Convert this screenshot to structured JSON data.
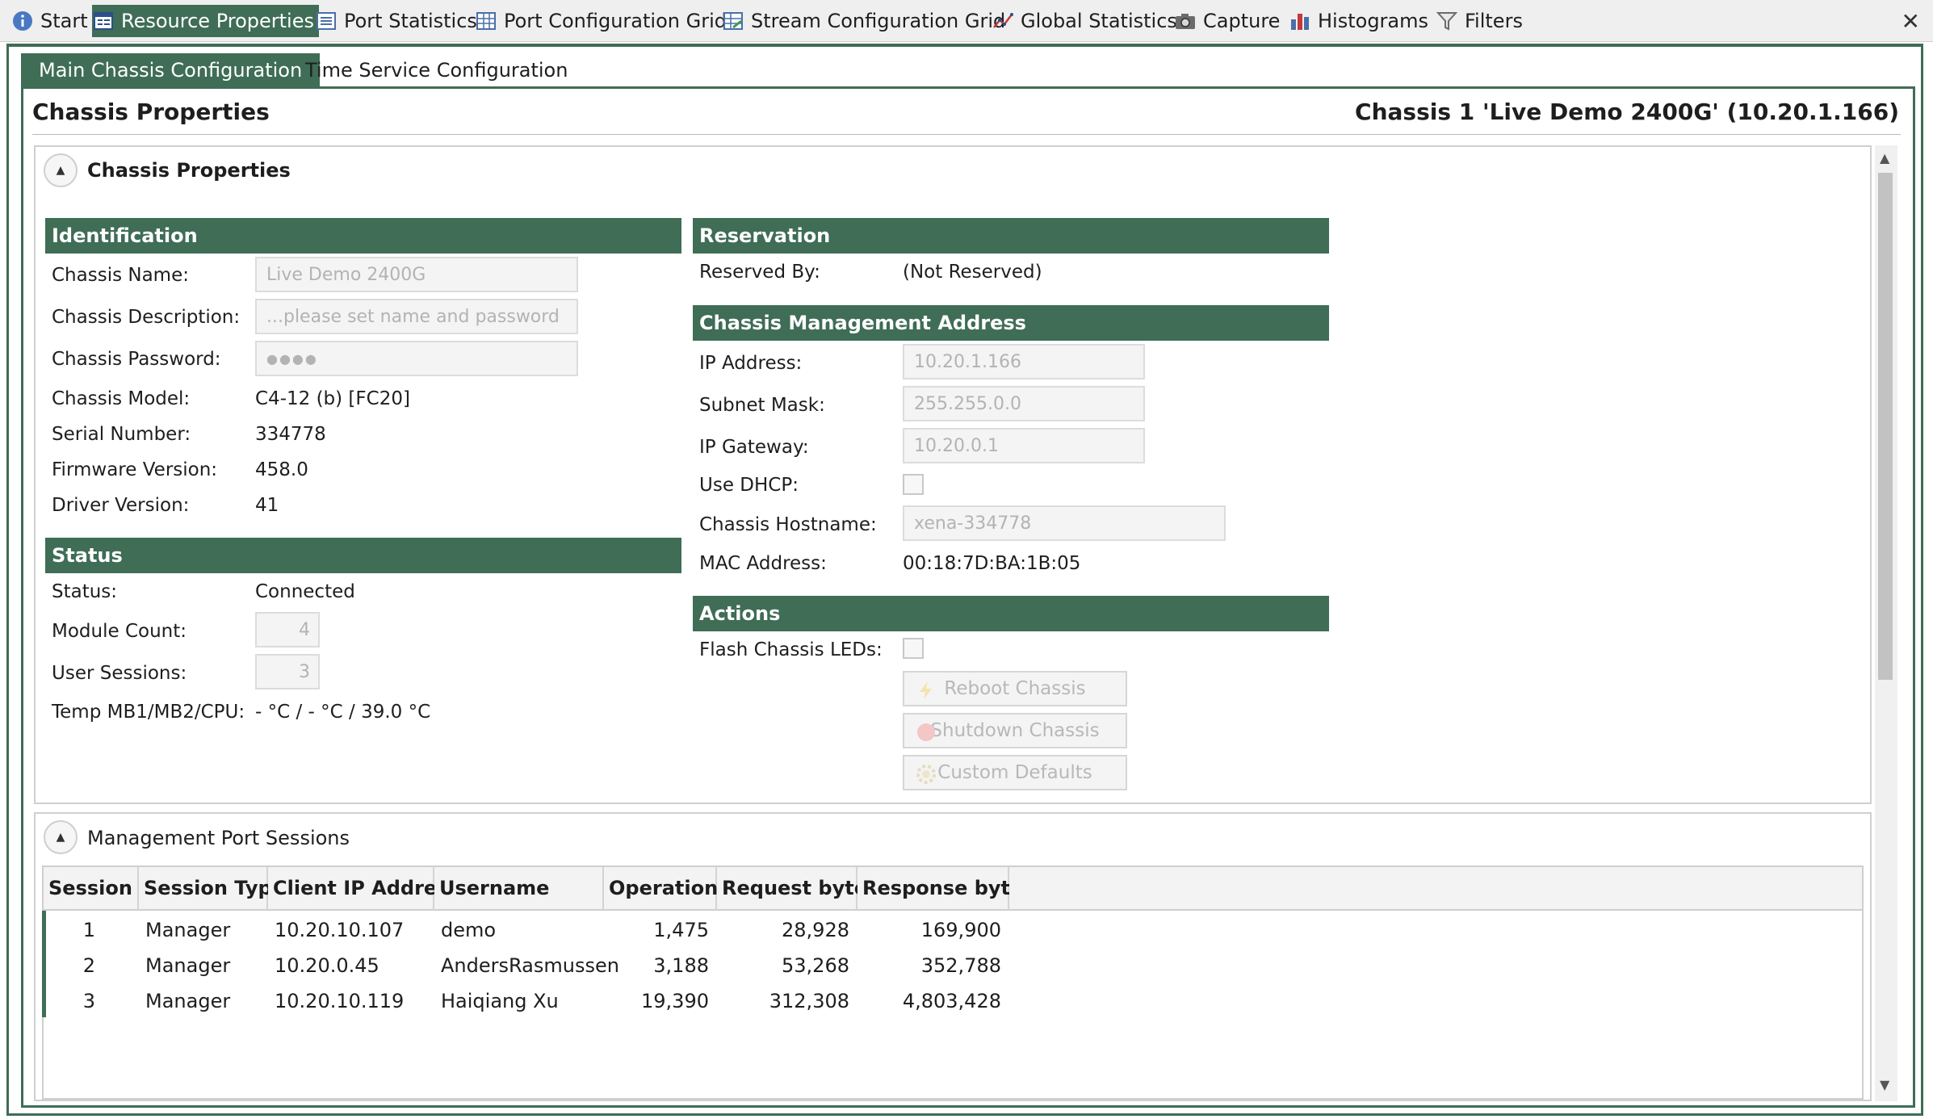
{
  "top_tabs": [
    {
      "label": "Start",
      "icon": "info-icon"
    },
    {
      "label": "Resource Properties",
      "icon": "properties-icon",
      "active": true
    },
    {
      "label": "Port Statistics",
      "icon": "list-icon"
    },
    {
      "label": "Port Configuration Grid",
      "icon": "grid-icon"
    },
    {
      "label": "Stream Configuration Grid",
      "icon": "grid-arrow-icon"
    },
    {
      "label": "Global Statistics",
      "icon": "line-chart-icon"
    },
    {
      "label": "Capture",
      "icon": "camera-icon"
    },
    {
      "label": "Histograms",
      "icon": "bar-chart-icon"
    },
    {
      "label": "Filters",
      "icon": "funnel-icon"
    }
  ],
  "close_glyph": "✕",
  "sub_tabs": [
    {
      "label": "Main Chassis Configuration",
      "active": true
    },
    {
      "label": "Time Service Configuration"
    }
  ],
  "header": {
    "title": "Chassis Properties",
    "chassis_label": "Chassis 1 'Live Demo 2400G' (10.20.1.166)"
  },
  "chassis_group": {
    "title": "Chassis Properties",
    "identification": {
      "header": "Identification",
      "name_label": "Chassis Name:",
      "name_value": "Live Demo 2400G",
      "desc_label": "Chassis Description:",
      "desc_value": "...please set name and password",
      "password_label": "Chassis Password:",
      "password_value": "●●●●",
      "model_label": "Chassis Model:",
      "model_value": "C4-12 (b) [FC20]",
      "serial_label": "Serial Number:",
      "serial_value": "334778",
      "firmware_label": "Firmware Version:",
      "firmware_value": "458.0",
      "driver_label": "Driver Version:",
      "driver_value": "41"
    },
    "status": {
      "header": "Status",
      "status_label": "Status:",
      "status_value": "Connected",
      "module_label": "Module Count:",
      "module_value": "4",
      "sessions_label": "User Sessions:",
      "sessions_value": "3",
      "temp_label": "Temp MB1/MB2/CPU:",
      "temp_value": "- °C / - °C / 39.0 °C"
    },
    "reservation": {
      "header": "Reservation",
      "reserved_label": "Reserved By:",
      "reserved_value": "(Not Reserved)"
    },
    "mgmt": {
      "header": "Chassis Management Address",
      "ip_label": "IP Address:",
      "ip_value": "10.20.1.166",
      "subnet_label": "Subnet Mask:",
      "subnet_value": "255.255.0.0",
      "gateway_label": "IP Gateway:",
      "gateway_value": "10.20.0.1",
      "dhcp_label": "Use DHCP:",
      "hostname_label": "Chassis Hostname:",
      "hostname_value": "xena-334778",
      "mac_label": "MAC Address:",
      "mac_value": "00:18:7D:BA:1B:05"
    },
    "actions": {
      "header": "Actions",
      "flash_label": "Flash Chassis LEDs:",
      "reboot_label": "Reboot Chassis",
      "shutdown_label": "Shutdown Chassis",
      "defaults_label": "Custom Defaults"
    }
  },
  "sessions_group": {
    "title": "Management Port Sessions",
    "columns": [
      "Session #",
      "Session Type",
      "Client IP Address",
      "Username",
      "Operations",
      "Request bytes",
      "Response bytes"
    ],
    "rows": [
      {
        "session": "1",
        "type": "Manager",
        "ip": "10.20.10.107",
        "user": "demo",
        "ops": "1,475",
        "req": "28,928",
        "resp": "169,900"
      },
      {
        "session": "2",
        "type": "Manager",
        "ip": "10.20.0.45",
        "user": "AndersRasmussen",
        "ops": "3,188",
        "req": "53,268",
        "resp": "352,788"
      },
      {
        "session": "3",
        "type": "Manager",
        "ip": "10.20.10.119",
        "user": "Haiqiang Xu",
        "ops": "19,390",
        "req": "312,308",
        "resp": "4,803,428"
      }
    ]
  },
  "colors": {
    "accent": "#3f6d56",
    "disabled_text": "#b3b3b3"
  }
}
